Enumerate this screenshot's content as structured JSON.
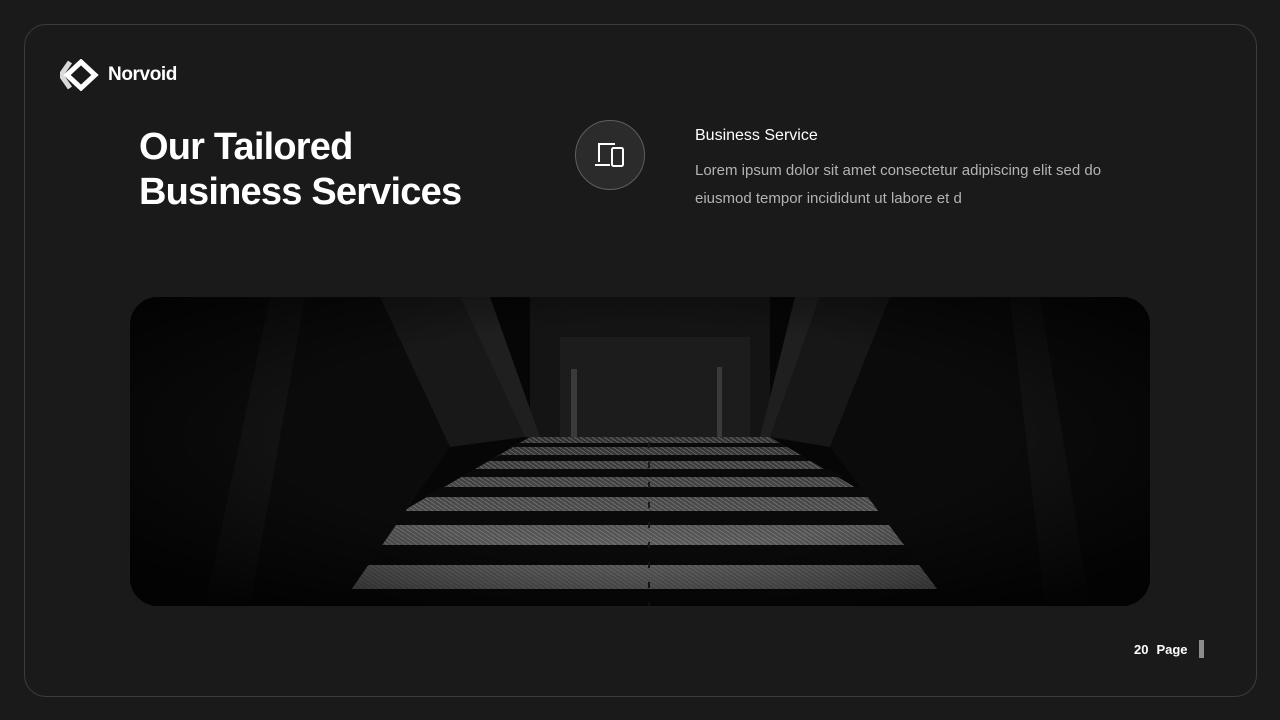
{
  "brand": {
    "name": "Norvoid",
    "logo_icon": "diamond-logo-icon"
  },
  "headline": {
    "line1": "Our Tailored",
    "line2": "Business Services"
  },
  "service": {
    "icon": "devices-icon",
    "title": "Business Service",
    "description": "Lorem ipsum dolor sit amet consectetur adipiscing elit sed do eiusmod tempor incididunt ut labore et d"
  },
  "hero_image": {
    "subject": "dark-corridor-photo"
  },
  "footer": {
    "page_number": "20",
    "page_label": "Page"
  },
  "colors": {
    "background": "#1a1a1a",
    "text_primary": "#ffffff",
    "text_muted": "#b3b3b3",
    "border": "#3c3c3c"
  }
}
